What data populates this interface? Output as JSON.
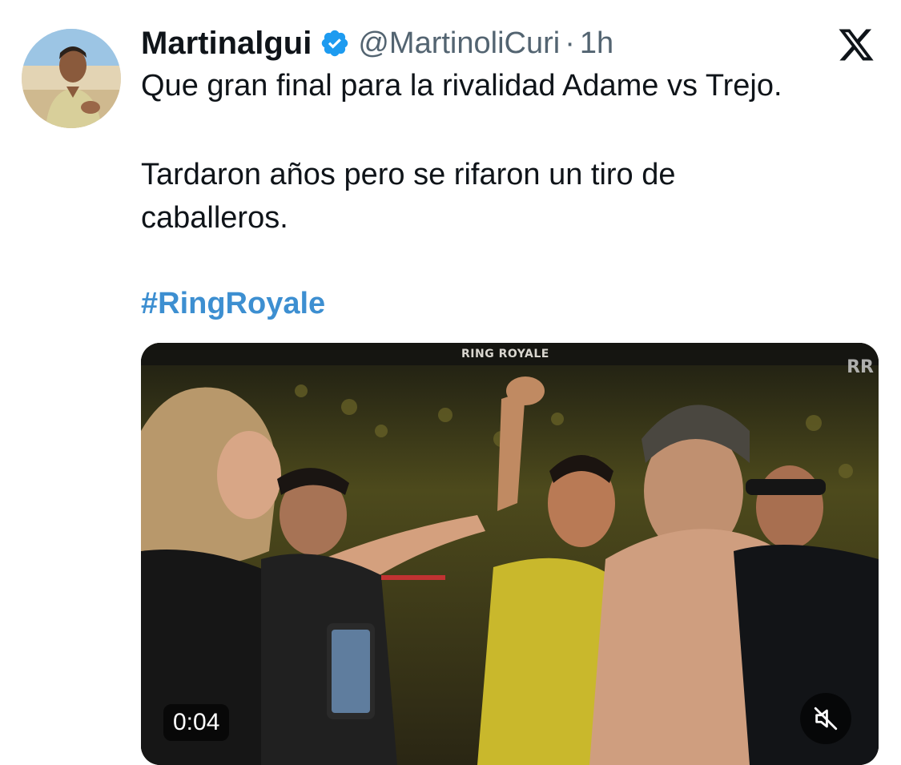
{
  "author": {
    "display_name": "Martinalgui",
    "handle": "@MartinoliCuri",
    "separator": "·",
    "time": "1h",
    "verified_color": "#1d9bf0"
  },
  "tweet": {
    "lines": [
      "Que gran final para la rivalidad Adame vs Trejo.",
      "Tardaron años pero se rifaron un tiro de",
      "caballeros."
    ],
    "hashtag": "#RingRoyale"
  },
  "media": {
    "banner_text": "RING ROYALE",
    "logo_text": "RR",
    "duration": "0:04",
    "mute_icon": "muted-speaker-icon"
  },
  "colors": {
    "text_primary": "#0f1419",
    "text_secondary": "#536471",
    "link": "#3d8fd1"
  }
}
